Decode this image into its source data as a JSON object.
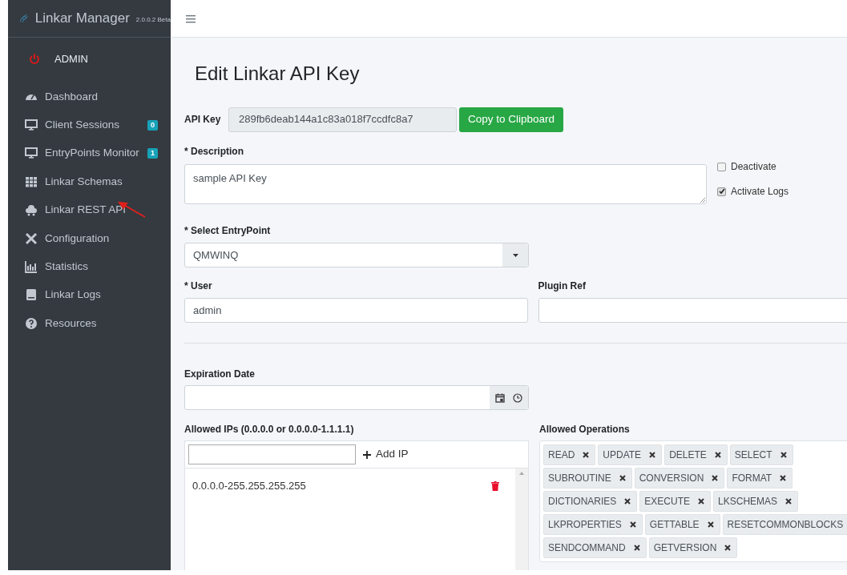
{
  "brand": {
    "name": "Linkar Manager",
    "version": "2.0.0.2 Beta"
  },
  "user": {
    "name": "ADMIN"
  },
  "sidebar": {
    "items": [
      {
        "label": "Dashboard",
        "selected": false
      },
      {
        "label": "Client Sessions",
        "badge": "0",
        "selected": false
      },
      {
        "label": "EntryPoints Monitor",
        "badge": "1",
        "selected": false
      },
      {
        "label": "Linkar Schemas",
        "selected": false
      },
      {
        "label": "Linkar REST API",
        "selected": false
      },
      {
        "label": "Configuration",
        "selected": false
      },
      {
        "label": "Statistics",
        "selected": false
      },
      {
        "label": "Linkar Logs",
        "selected": false
      },
      {
        "label": "Resources",
        "selected": false
      }
    ]
  },
  "page": {
    "title": "Edit Linkar API Key"
  },
  "form": {
    "api_key": {
      "label": "API Key",
      "value": "289fb6deab144a1c83a018f7ccdfc8a7",
      "button": "Copy to Clipboard"
    },
    "description": {
      "label": "* Description",
      "value": "sample API Key"
    },
    "options": [
      {
        "label": "Deactivate",
        "checked": false
      },
      {
        "label": "Activate Logs",
        "checked": true
      }
    ],
    "entrypoint": {
      "label": "* Select EntryPoint",
      "value": "QMWINQ"
    },
    "user": {
      "label": "* User",
      "value": "admin"
    },
    "plugin_ref": {
      "label": "Plugin Ref"
    },
    "expiration": {
      "label": "Expiration Date"
    },
    "allowed_ips": {
      "label": "Allowed IPs (0.0.0.0 or 0.0.0.0-1.1.1.1)",
      "add_button": "Add IP",
      "items": [
        "0.0.0.0-255.255.255.255"
      ]
    },
    "allowed_operations": {
      "label": "Allowed Operations",
      "items": [
        "READ",
        "UPDATE",
        "DELETE",
        "SELECT",
        "SUBROUTINE",
        "CONVERSION",
        "FORMAT",
        "DICTIONARIES",
        "EXECUTE",
        "LKSCHEMAS",
        "LKPROPERTIES",
        "GETTABLE",
        "RESETCOMMONBLOCKS",
        "SENDCOMMAND",
        "GETVERSION"
      ]
    }
  }
}
